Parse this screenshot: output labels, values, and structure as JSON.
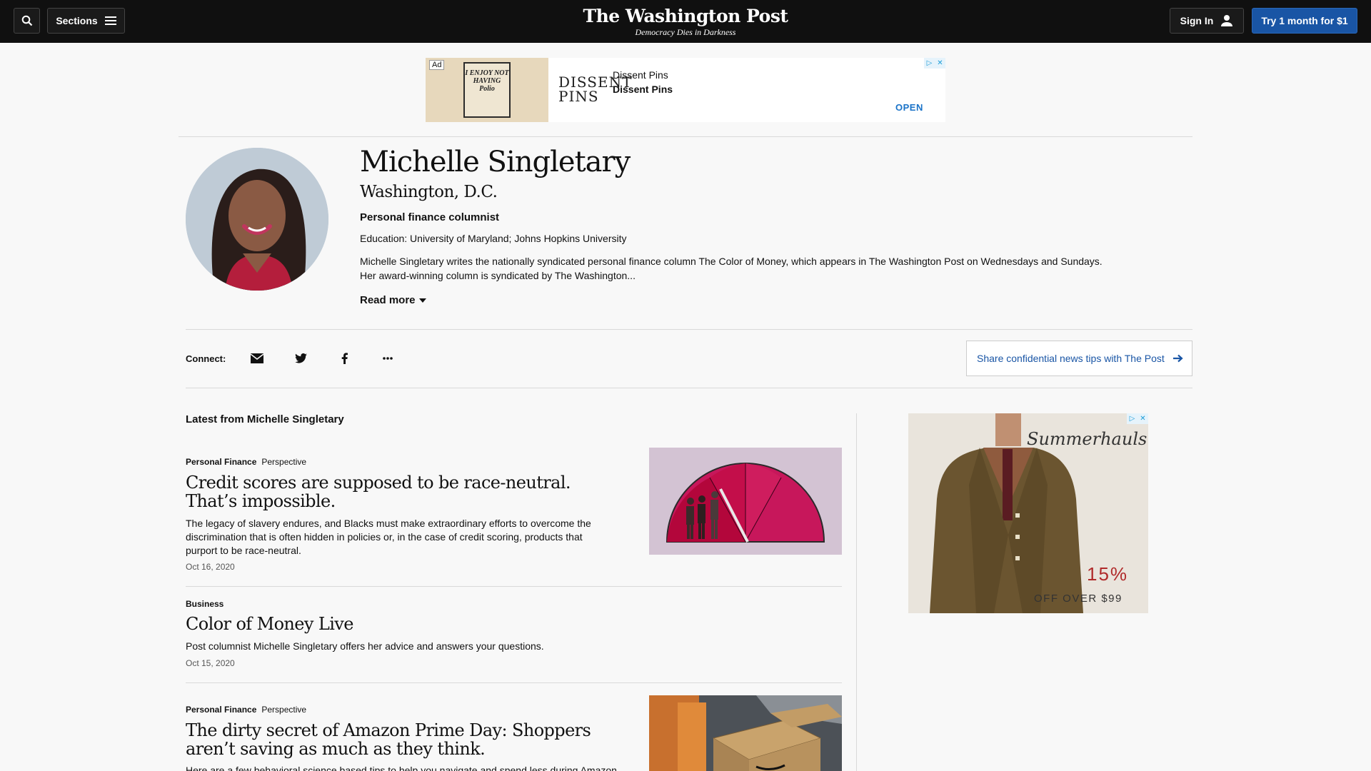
{
  "header": {
    "sections_label": "Sections",
    "logo": "The Washington Post",
    "tagline": "Democracy Dies in Darkness",
    "signin_label": "Sign In",
    "subscribe_label": "Try 1 month for $1"
  },
  "top_ad": {
    "ad_label": "Ad",
    "poster_text": "I ENJOY NOT HAVING Polio",
    "brand_logo": "DISSENT PINS",
    "line1": "Dissent Pins",
    "line2": "Dissent Pins",
    "cta": "OPEN"
  },
  "profile": {
    "name": "Michelle Singletary",
    "location": "Washington, D.C.",
    "role": "Personal finance columnist",
    "education": "Education: University of Maryland; Johns Hopkins University",
    "bio": "Michelle Singletary writes the nationally syndicated personal finance column The Color of Money, which appears in The Washington Post on Wednesdays and Sundays. Her award-winning column is syndicated by The Washington...",
    "read_more": "Read more"
  },
  "connect": {
    "label": "Connect:",
    "icons": [
      "email-icon",
      "twitter-icon",
      "facebook-icon",
      "more-icon"
    ],
    "tip_button": "Share confidential news tips with The Post"
  },
  "latest": {
    "heading": "Latest from Michelle Singletary",
    "articles": [
      {
        "section": "Personal Finance",
        "label": "Perspective",
        "headline": "Credit scores are supposed to be race-neutral. That’s impossible.",
        "blurb": "The legacy of slavery endures, and Blacks must make extraordinary efforts to overcome the discrimination that is often hidden in policies or, in the case of credit scoring, products that purport to be race-neutral.",
        "date": "Oct 16, 2020"
      },
      {
        "section": "Business",
        "label": "",
        "headline": "Color of Money Live",
        "blurb": "Post columnist Michelle Singletary offers her advice and answers your questions.",
        "date": "Oct 15, 2020"
      },
      {
        "section": "Personal Finance",
        "label": "Perspective",
        "headline": "The dirty secret of Amazon Prime Day: Shoppers aren’t saving as much as they think.",
        "blurb": "Here are a few behavioral science based tips to help you navigate and spend less during Amazon",
        "date": ""
      }
    ]
  },
  "side_ad": {
    "brand": "Summerhauls",
    "percent": "15%",
    "offer": "OFF OVER $99"
  },
  "colors": {
    "header_bg": "#101010",
    "accent_blue": "#1955a5",
    "link_blue": "#1a73c8"
  }
}
